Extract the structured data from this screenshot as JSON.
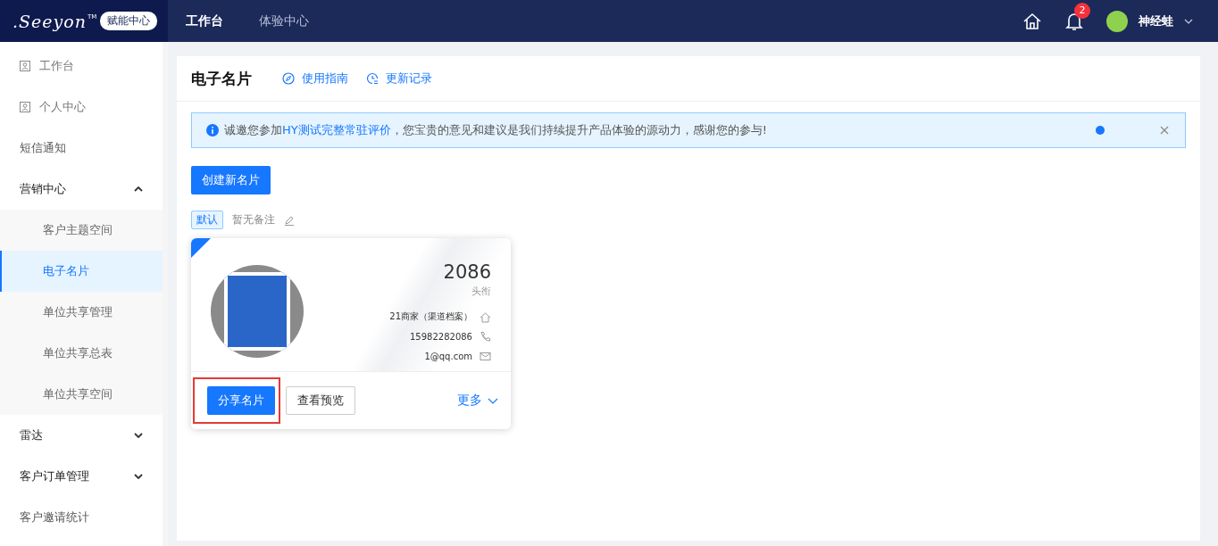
{
  "topbar": {
    "logo": ".Seeyon",
    "logo_mark": "TM",
    "badge": "赋能中心",
    "nav": [
      {
        "label": "工作台",
        "selected": true
      },
      {
        "label": "体验中心",
        "selected": false
      }
    ],
    "notifications": "2",
    "user": "神经蛙"
  },
  "sidebar": {
    "items": [
      {
        "kind": "icon",
        "label": "工作台"
      },
      {
        "kind": "icon",
        "label": "个人中心"
      },
      {
        "kind": "plain",
        "label": "短信通知"
      },
      {
        "kind": "group",
        "label": "营销中心",
        "expanded": true,
        "children": [
          {
            "label": "客户主题空间",
            "selected": false
          },
          {
            "label": "电子名片",
            "selected": true
          },
          {
            "label": "单位共享管理",
            "selected": false
          },
          {
            "label": "单位共享总表",
            "selected": false
          },
          {
            "label": "单位共享空间",
            "selected": false
          }
        ]
      },
      {
        "kind": "group",
        "label": "雷达",
        "expanded": false
      },
      {
        "kind": "group",
        "label": "客户订单管理",
        "expanded": false
      },
      {
        "kind": "plain",
        "label": "客户邀请统计"
      }
    ]
  },
  "page": {
    "title": "电子名片",
    "links": [
      {
        "kind": "guide",
        "label": "使用指南"
      },
      {
        "kind": "history",
        "label": "更新记录"
      }
    ],
    "alert": {
      "before": "诚邀您参加",
      "link": "HY测试完整常驻评价",
      "after": "，您宝贵的意见和建议是我们持续提升产品体验的源动力，感谢您的参与!"
    },
    "create_button": "创建新名片",
    "card_meta": {
      "tag": "默认",
      "note": "暂无备注"
    },
    "card": {
      "name": "2086",
      "title": "头衔",
      "info": [
        {
          "kind": "company",
          "text": "21商家（渠道档案）"
        },
        {
          "kind": "phone",
          "text": "15982282086"
        },
        {
          "kind": "email",
          "text": "1@qq.com"
        }
      ],
      "actions": [
        {
          "label": "分享名片",
          "primary": true
        },
        {
          "label": "查看预览",
          "primary": false
        }
      ],
      "more": "更多"
    }
  }
}
